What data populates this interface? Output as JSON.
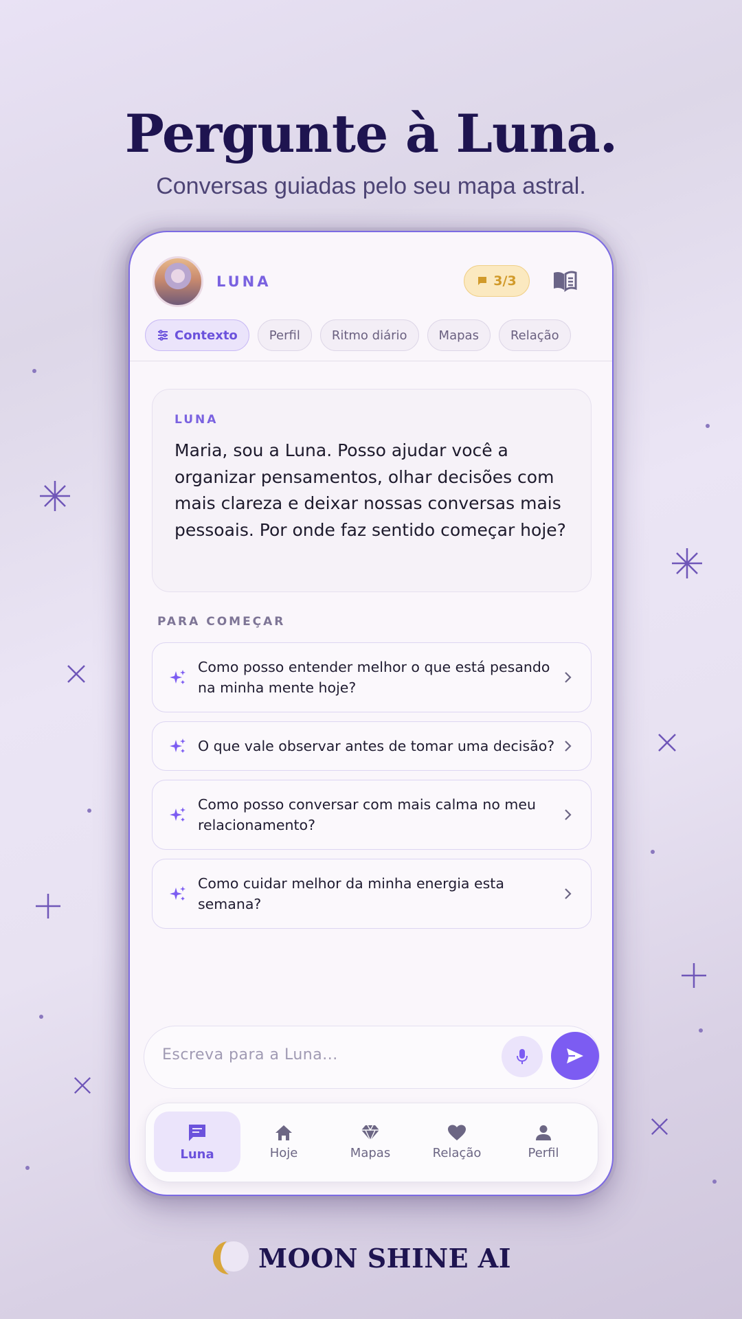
{
  "headline": "Pergunte à Luna.",
  "subheadline": "Conversas guiadas pelo seu mapa astral.",
  "header": {
    "assistant_name": "LUNA",
    "message_counter": "3/3",
    "avatar_icon": "luna-avatar",
    "book_icon": "book-icon"
  },
  "chips": [
    {
      "label": "Contexto",
      "active": true
    },
    {
      "label": "Perfil"
    },
    {
      "label": "Ritmo diário"
    },
    {
      "label": "Mapas"
    },
    {
      "label": "Relação"
    }
  ],
  "message": {
    "sender": "LUNA",
    "text": "Maria, sou a Luna. Posso ajudar você a organizar pensamentos, olhar decisões com mais clareza e deixar nossas conversas mais pessoais. Por onde faz sentido começar hoje?"
  },
  "suggestions": {
    "section_label": "PARA COMEÇAR",
    "items": [
      "Como posso entender melhor o que está pesando na minha mente hoje?",
      "O que vale observar antes de tomar uma decisão?",
      "Como posso conversar com mais calma no meu relacionamento?",
      "Como cuidar melhor da minha energia esta semana?"
    ]
  },
  "composer": {
    "placeholder": "Escreva para a Luna..."
  },
  "tabs": [
    {
      "label": "Luna",
      "icon": "chat-icon",
      "active": true
    },
    {
      "label": "Hoje",
      "icon": "home-icon"
    },
    {
      "label": "Mapas",
      "icon": "gem-icon"
    },
    {
      "label": "Relação",
      "icon": "heart-icon"
    },
    {
      "label": "Perfil",
      "icon": "person-icon"
    }
  ],
  "brand": "MOON SHINE AI",
  "colors": {
    "accent": "#7c5cf2",
    "brand_navy": "#1e1450",
    "badge_gold": "#d19a2a"
  }
}
